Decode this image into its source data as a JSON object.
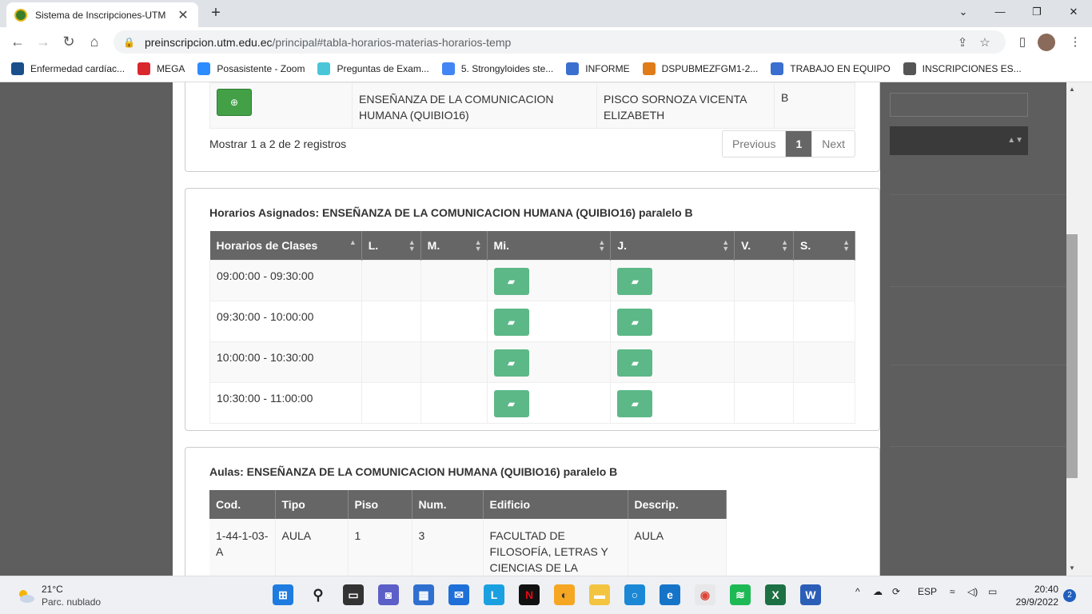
{
  "browser": {
    "tab_title": "Sistema de Inscripciones-UTM",
    "url_host": "preinscripcion.utm.edu.ec",
    "url_path": "/principal#tabla-horarios-materias-horarios-temp"
  },
  "bookmarks": [
    {
      "label": "Enfermedad cardíac...",
      "icon": "globe-icon",
      "color": "#1a4f8b"
    },
    {
      "label": "MEGA",
      "icon": "mega-icon",
      "color": "#d9272e"
    },
    {
      "label": "Posasistente - Zoom",
      "icon": "zoom-icon",
      "color": "#2d8cff"
    },
    {
      "label": "Preguntas de Exam...",
      "icon": "quizlet-icon",
      "color": "#4ac6d9"
    },
    {
      "label": "5. Strongyloides ste...",
      "icon": "google-icon",
      "color": "#4285f4"
    },
    {
      "label": "INFORME",
      "icon": "form-icon",
      "color": "#3b6fcf"
    },
    {
      "label": "DSPUBMEZFGM1-2...",
      "icon": "moodle-icon",
      "color": "#e07b1a"
    },
    {
      "label": "TRABAJO EN EQUIPO",
      "icon": "form-icon",
      "color": "#3b6fcf"
    },
    {
      "label": "INSCRIPCIONES ES...",
      "icon": "globe-icon",
      "color": "#555555"
    }
  ],
  "materias_table": {
    "row": {
      "materia": "ENSEÑANZA DE LA COMUNICACION HUMANA (QUIBIO16)",
      "docente": "PISCO SORNOZA VICENTA ELIZABETH",
      "paralelo": "B"
    },
    "info": "Mostrar 1 a 2 de 2 registros",
    "pagination": {
      "previous": "Previous",
      "current": "1",
      "next": "Next"
    }
  },
  "horarios": {
    "title": "Horarios Asignados: ENSEÑANZA DE LA COMUNICACION HUMANA (QUIBIO16) paralelo B",
    "columns": [
      "Horarios de Clases",
      "L.",
      "M.",
      "Mi.",
      "J.",
      "V.",
      "S."
    ],
    "rows": [
      {
        "time": "09:00:00 - 09:30:00",
        "days": [
          false,
          false,
          true,
          true,
          false,
          false
        ]
      },
      {
        "time": "09:30:00 - 10:00:00",
        "days": [
          false,
          false,
          true,
          true,
          false,
          false
        ]
      },
      {
        "time": "10:00:00 - 10:30:00",
        "days": [
          false,
          false,
          true,
          true,
          false,
          false
        ]
      },
      {
        "time": "10:30:00 - 11:00:00",
        "days": [
          false,
          false,
          true,
          true,
          false,
          false
        ]
      }
    ]
  },
  "aulas": {
    "title": "Aulas: ENSEÑANZA DE LA COMUNICACION HUMANA (QUIBIO16) paralelo B",
    "columns": [
      "Cod.",
      "Tipo",
      "Piso",
      "Num.",
      "Edificio",
      "Descrip."
    ],
    "row": {
      "cod": "1-44-1-03-A",
      "tipo": "AULA",
      "piso": "1",
      "num": "3",
      "edificio": "FACULTAD DE FILOSOFÍA, LETRAS Y CIENCIAS DE LA",
      "descrip": "AULA"
    }
  },
  "taskbar": {
    "weather_temp": "21°C",
    "weather_desc": "Parc. nublado",
    "lang": "ESP",
    "time": "20:40",
    "date": "29/9/2022",
    "notifications": "2"
  }
}
